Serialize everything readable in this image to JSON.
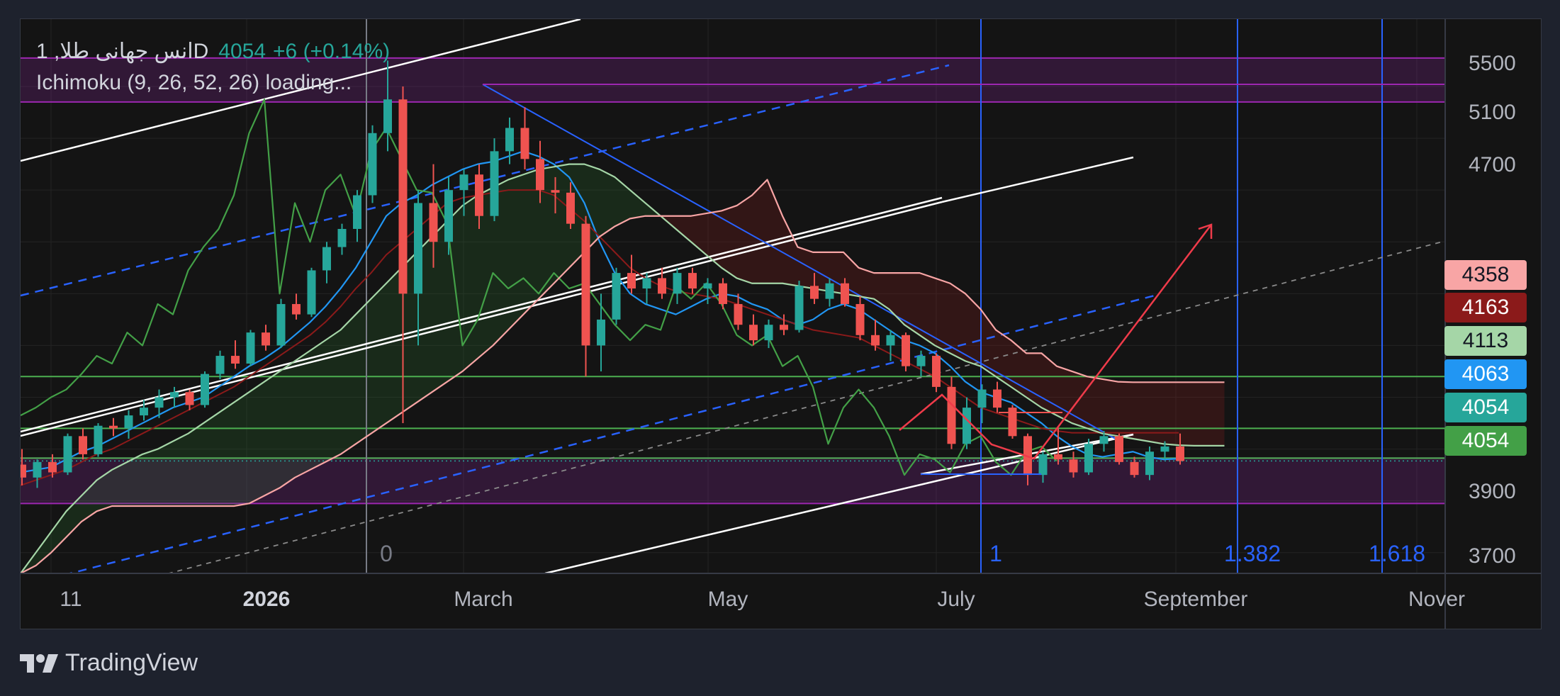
{
  "header": {
    "symbol": "1 ,انس جهانی طلاD",
    "price": "4054",
    "change": "+6 (+0.14%)",
    "indicator": "Ichimoku (9, 26, 52, 26) loading..."
  },
  "brand": {
    "name": "TradingView",
    "logo_icon": "tradingview-logo-icon"
  },
  "colors": {
    "background": "#141414",
    "up": "#26a69a",
    "down": "#ef5350",
    "tenkan": "#2196f3",
    "kijun": "#8b1a1a",
    "chikou": "#43a047",
    "senkou_a": "#a5d6a7",
    "senkou_b": "#f8a5a5",
    "zone": "#9c27b0",
    "fib": "#2962ff",
    "trend": "#ffffff",
    "arrow": "#ef3b4a"
  },
  "price_labels": [
    {
      "value": "4358",
      "bg": "#f8a5a5",
      "fg": "#131722"
    },
    {
      "value": "4163",
      "bg": "#8b1a1a",
      "fg": "#ffffff"
    },
    {
      "value": "4113",
      "bg": "#a5d6a7",
      "fg": "#131722"
    },
    {
      "value": "4063",
      "bg": "#2196f3",
      "fg": "#ffffff"
    },
    {
      "value": "4054",
      "bg": "#26a69a",
      "fg": "#ffffff"
    },
    {
      "value": "4054",
      "bg": "#43a047",
      "fg": "#ffffff"
    }
  ],
  "fib_labels": [
    "0",
    "1",
    "1.382",
    "1.618"
  ],
  "chart_data": {
    "type": "line",
    "x_axis": {
      "ticks": [
        "11",
        "2026",
        "March",
        "May",
        "July",
        "September",
        "Nover"
      ],
      "bold_tick": "2026"
    },
    "y_axis": {
      "ticks": [
        5500,
        5100,
        4700,
        3900,
        3700
      ],
      "range": [
        3620,
        5760
      ]
    },
    "candles": [
      [
        4040,
        4100,
        3960,
        3990
      ],
      [
        3990,
        4060,
        3950,
        4050
      ],
      [
        4050,
        4080,
        3990,
        4010
      ],
      [
        4010,
        4160,
        4000,
        4150
      ],
      [
        4150,
        4180,
        4060,
        4080
      ],
      [
        4080,
        4200,
        4070,
        4190
      ],
      [
        4190,
        4220,
        4150,
        4180
      ],
      [
        4180,
        4250,
        4140,
        4230
      ],
      [
        4230,
        4290,
        4210,
        4260
      ],
      [
        4260,
        4330,
        4220,
        4300
      ],
      [
        4300,
        4340,
        4260,
        4320
      ],
      [
        4320,
        4330,
        4250,
        4270
      ],
      [
        4270,
        4400,
        4260,
        4390
      ],
      [
        4390,
        4480,
        4370,
        4460
      ],
      [
        4460,
        4520,
        4410,
        4430
      ],
      [
        4430,
        4560,
        4420,
        4550
      ],
      [
        4550,
        4580,
        4480,
        4500
      ],
      [
        4500,
        4680,
        4490,
        4660
      ],
      [
        4660,
        4700,
        4600,
        4620
      ],
      [
        4620,
        4800,
        4610,
        4790
      ],
      [
        4790,
        4900,
        4740,
        4880
      ],
      [
        4880,
        4970,
        4850,
        4950
      ],
      [
        4950,
        5100,
        4900,
        5080
      ],
      [
        5080,
        5350,
        5050,
        5320
      ],
      [
        5320,
        5600,
        5250,
        5450
      ],
      [
        5450,
        5500,
        4200,
        4700
      ],
      [
        4700,
        5100,
        4500,
        5050
      ],
      [
        5050,
        5200,
        4800,
        4900
      ],
      [
        4900,
        5150,
        4850,
        5100
      ],
      [
        5100,
        5180,
        5000,
        5160
      ],
      [
        5160,
        5200,
        4950,
        5000
      ],
      [
        5000,
        5300,
        4980,
        5250
      ],
      [
        5250,
        5380,
        5200,
        5340
      ],
      [
        5340,
        5420,
        5180,
        5220
      ],
      [
        5220,
        5290,
        5050,
        5100
      ],
      [
        5100,
        5150,
        5010,
        5090
      ],
      [
        5090,
        5130,
        4950,
        4970
      ],
      [
        4970,
        5000,
        4380,
        4500
      ],
      [
        4500,
        4700,
        4400,
        4600
      ],
      [
        4600,
        4800,
        4580,
        4780
      ],
      [
        4780,
        4850,
        4700,
        4720
      ],
      [
        4720,
        4780,
        4660,
        4760
      ],
      [
        4760,
        4800,
        4680,
        4700
      ],
      [
        4700,
        4800,
        4660,
        4780
      ],
      [
        4780,
        4800,
        4700,
        4720
      ],
      [
        4720,
        4760,
        4660,
        4740
      ],
      [
        4740,
        4760,
        4640,
        4660
      ],
      [
        4660,
        4700,
        4560,
        4580
      ],
      [
        4580,
        4620,
        4500,
        4520
      ],
      [
        4520,
        4600,
        4490,
        4580
      ],
      [
        4580,
        4620,
        4540,
        4560
      ],
      [
        4560,
        4750,
        4550,
        4730
      ],
      [
        4730,
        4780,
        4660,
        4680
      ],
      [
        4680,
        4760,
        4650,
        4740
      ],
      [
        4740,
        4760,
        4650,
        4660
      ],
      [
        4660,
        4690,
        4520,
        4540
      ],
      [
        4540,
        4600,
        4480,
        4500
      ],
      [
        4500,
        4560,
        4440,
        4540
      ],
      [
        4540,
        4550,
        4400,
        4420
      ],
      [
        4420,
        4480,
        4380,
        4460
      ],
      [
        4460,
        4470,
        4320,
        4340
      ],
      [
        4340,
        4380,
        4100,
        4120
      ],
      [
        4120,
        4300,
        4100,
        4260
      ],
      [
        4260,
        4350,
        4200,
        4330
      ],
      [
        4330,
        4360,
        4240,
        4260
      ],
      [
        4260,
        4270,
        4140,
        4150
      ],
      [
        4150,
        4160,
        3960,
        4000
      ],
      [
        4000,
        4090,
        3970,
        4080
      ],
      [
        4080,
        4180,
        4040,
        4060
      ],
      [
        4060,
        4090,
        3990,
        4010
      ],
      [
        4010,
        4140,
        4000,
        4120
      ],
      [
        4120,
        4170,
        4090,
        4150
      ],
      [
        4150,
        4160,
        4040,
        4050
      ],
      [
        4050,
        4070,
        3990,
        4000
      ],
      [
        4000,
        4110,
        3980,
        4090
      ],
      [
        4090,
        4130,
        4060,
        4110
      ],
      [
        4110,
        4160,
        4040,
        4054
      ]
    ],
    "series": [
      {
        "name": "tenkan",
        "color": "#2196f3",
        "values": [
          4010,
          4020,
          4030,
          4060,
          4090,
          4110,
          4140,
          4170,
          4200,
          4230,
          4260,
          4280,
          4300,
          4340,
          4380,
          4420,
          4450,
          4490,
          4540,
          4590,
          4650,
          4720,
          4800,
          4900,
          5000,
          5050,
          5080,
          5120,
          5150,
          5180,
          5200,
          5210,
          5230,
          5250,
          5230,
          5200,
          5150,
          5050,
          4900,
          4780,
          4700,
          4660,
          4640,
          4620,
          4650,
          4680,
          4700,
          4690,
          4660,
          4640,
          4600,
          4580,
          4600,
          4640,
          4660,
          4640,
          4600,
          4560,
          4520,
          4500,
          4470,
          4420,
          4360,
          4320,
          4300,
          4280,
          4240,
          4200,
          4150,
          4110,
          4080,
          4070,
          4080,
          4090,
          4070,
          4060,
          4063
        ]
      },
      {
        "name": "kijun",
        "color": "#8b1a1a",
        "values": [
          3960,
          3980,
          4000,
          4020,
          4050,
          4080,
          4100,
          4130,
          4160,
          4190,
          4220,
          4250,
          4280,
          4310,
          4340,
          4380,
          4420,
          4460,
          4500,
          4540,
          4590,
          4650,
          4720,
          4780,
          4850,
          4900,
          4950,
          5000,
          5050,
          5070,
          5080,
          5090,
          5100,
          5100,
          5100,
          5080,
          5030,
          4980,
          4920,
          4860,
          4800,
          4760,
          4730,
          4710,
          4700,
          4690,
          4680,
          4660,
          4640,
          4620,
          4600,
          4580,
          4560,
          4550,
          4540,
          4530,
          4500,
          4470,
          4440,
          4410,
          4380,
          4340,
          4300,
          4260,
          4240,
          4220,
          4200,
          4180,
          4170,
          4163,
          4163,
          4163,
          4163,
          4163,
          4163,
          4163,
          4163
        ]
      },
      {
        "name": "chikou",
        "color": "#43a047",
        "values": [
          4230,
          4260,
          4300,
          4330,
          4390,
          4460,
          4430,
          4550,
          4500,
          4660,
          4620,
          4790,
          4880,
          4950,
          5080,
          5320,
          5450,
          4700,
          5050,
          4900,
          5100,
          5160,
          5000,
          5250,
          5340,
          5220,
          5100,
          5090,
          4970,
          4500,
          4600,
          4780,
          4720,
          4760,
          4700,
          4780,
          4720,
          4740,
          4660,
          4580,
          4520,
          4580,
          4560,
          4730,
          4680,
          4740,
          4660,
          4540,
          4500,
          4540,
          4420,
          4460,
          4340,
          4120,
          4260,
          4330,
          4260,
          4150,
          4000,
          4080,
          4060,
          4010,
          4120,
          4150,
          4050,
          4000,
          4090,
          4110,
          4054
        ]
      },
      {
        "name": "senkou_a",
        "color": "#a5d6a7",
        "values": [
          3620,
          3700,
          3780,
          3860,
          3920,
          3980,
          4020,
          4050,
          4080,
          4100,
          4130,
          4160,
          4200,
          4240,
          4280,
          4320,
          4360,
          4400,
          4440,
          4480,
          4520,
          4560,
          4620,
          4680,
          4740,
          4800,
          4860,
          4920,
          4980,
          5040,
          5080,
          5110,
          5140,
          5160,
          5180,
          5190,
          5200,
          5200,
          5180,
          5150,
          5100,
          5050,
          5000,
          4950,
          4900,
          4850,
          4800,
          4760,
          4740,
          4740,
          4740,
          4730,
          4720,
          4710,
          4700,
          4690,
          4680,
          4640,
          4580,
          4540,
          4500,
          4470,
          4440,
          4420,
          4380,
          4340,
          4300,
          4260,
          4230,
          4200,
          4180,
          4160,
          4150,
          4140,
          4130,
          4120,
          4115,
          4113,
          4113,
          4113
        ]
      },
      {
        "name": "senkou_b",
        "color": "#f8a5a5",
        "values": [
          3620,
          3650,
          3700,
          3760,
          3820,
          3860,
          3880,
          3880,
          3880,
          3880,
          3880,
          3880,
          3880,
          3880,
          3880,
          3890,
          3920,
          3950,
          3990,
          4020,
          4050,
          4080,
          4120,
          4160,
          4200,
          4240,
          4280,
          4320,
          4360,
          4400,
          4450,
          4500,
          4560,
          4620,
          4680,
          4740,
          4800,
          4860,
          4920,
          4960,
          4990,
          5000,
          5000,
          5000,
          5000,
          5010,
          5020,
          5040,
          5080,
          5140,
          5000,
          4880,
          4860,
          4860,
          4860,
          4800,
          4780,
          4780,
          4780,
          4780,
          4760,
          4740,
          4700,
          4640,
          4560,
          4520,
          4470,
          4470,
          4420,
          4400,
          4380,
          4370,
          4360,
          4358,
          4358,
          4358,
          4358,
          4358,
          4358,
          4358
        ]
      }
    ],
    "trendlines": {
      "channel_upper": [
        [
          0,
          5160
        ],
        [
          400,
          5930
        ]
      ],
      "channel_lower": [
        [
          360,
          3640
        ],
        [
          1600,
          4150
        ]
      ]
    },
    "zones": [
      {
        "from": 5440,
        "to": 5610
      },
      {
        "from": 3890,
        "to": 4065
      }
    ],
    "horizontal_levels": [
      4380,
      4180,
      4065
    ],
    "last_price": 4054,
    "grid": true
  }
}
